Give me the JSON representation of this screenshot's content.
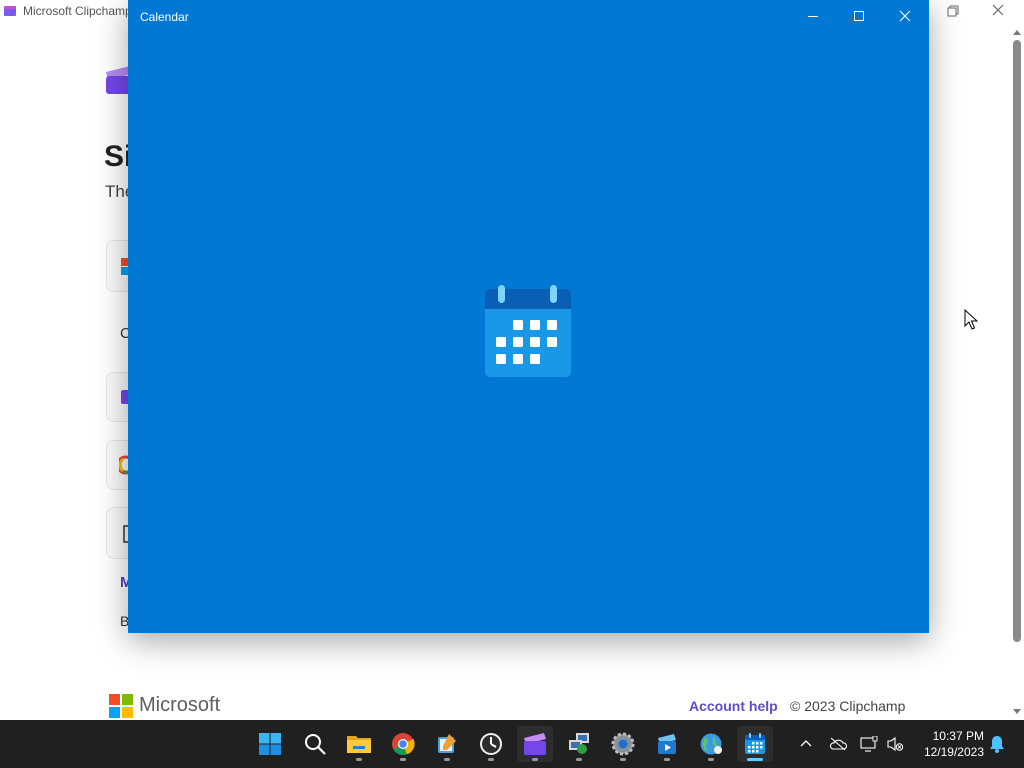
{
  "background_window": {
    "title": "Microsoft Clipchamp",
    "heading_fragment": "Si",
    "subtitle_fragment": "The",
    "option_fragments": [
      "C",
      "M",
      "B"
    ],
    "footer": {
      "brand": "Microsoft",
      "account_help": "Account help",
      "copyright": "© 2023 Clipchamp"
    }
  },
  "calendar_window": {
    "title": "Calendar",
    "background_color": "#0078d4"
  },
  "taskbar": {
    "apps": [
      {
        "name": "start-icon"
      },
      {
        "name": "search-icon"
      },
      {
        "name": "file-explorer-icon"
      },
      {
        "name": "chrome-icon"
      },
      {
        "name": "paint-icon"
      },
      {
        "name": "clock-app-icon"
      },
      {
        "name": "clipchamp-icon"
      },
      {
        "name": "network-tool-icon"
      },
      {
        "name": "settings-icon"
      },
      {
        "name": "media-player-icon"
      },
      {
        "name": "globe-icon"
      },
      {
        "name": "calendar-icon"
      }
    ],
    "time": "10:37 PM",
    "date": "12/19/2023"
  }
}
